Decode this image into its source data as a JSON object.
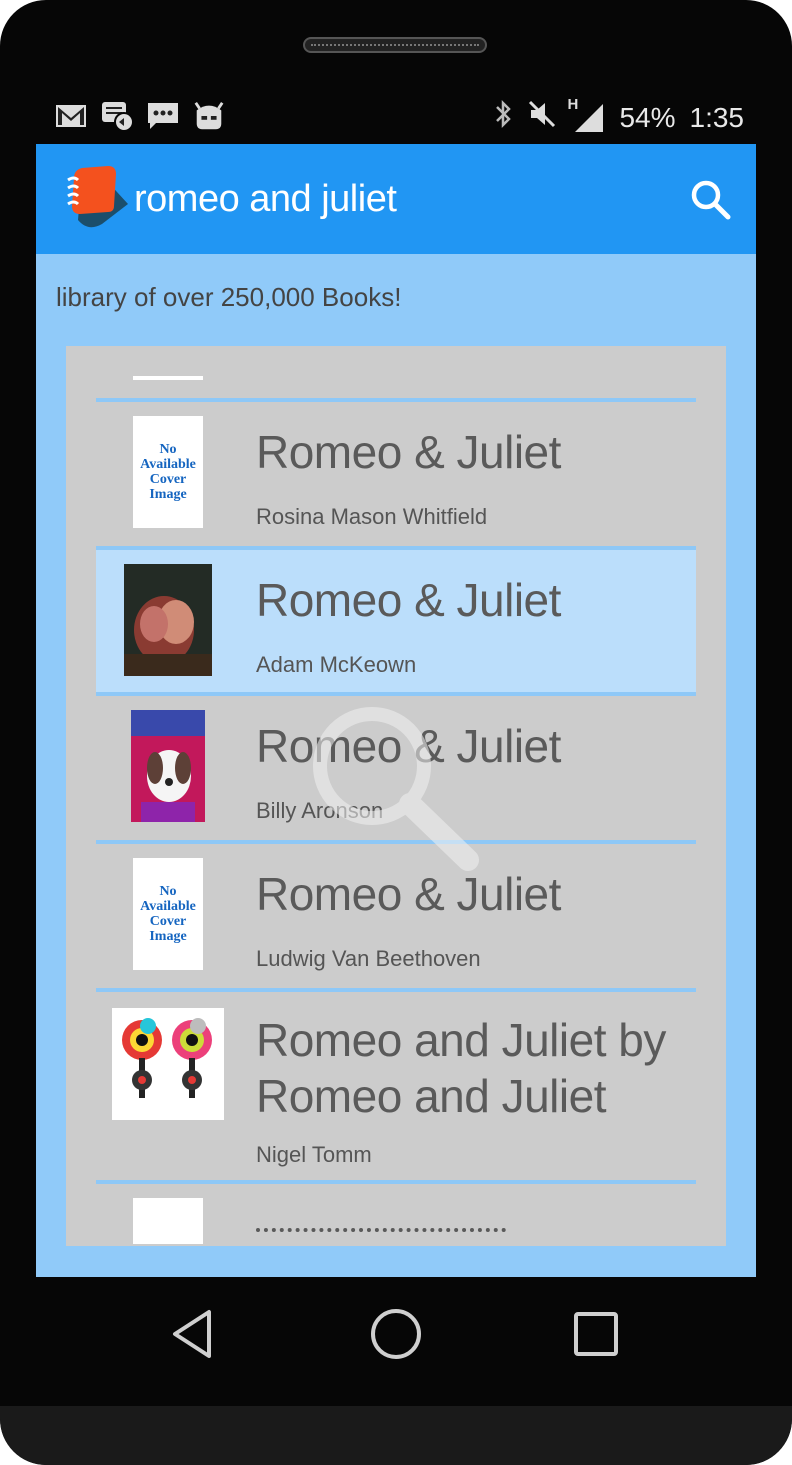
{
  "status_bar": {
    "battery": "54%",
    "time": "1:35",
    "network": "H",
    "icons": [
      "gmail-icon",
      "message-sync-icon",
      "sms-icon",
      "cyanogen-icon",
      "bluetooth-icon",
      "mute-icon",
      "signal-icon"
    ]
  },
  "app_bar": {
    "title": "romeo and juliet",
    "search_icon": "search-icon",
    "accent": "#2196f3"
  },
  "subtitle": "library of over 250,000 Books!",
  "placeholder_cover": {
    "line1": "No",
    "line2": "Available",
    "line3": "Cover",
    "line4": "Image"
  },
  "books": [
    {
      "title": "Romeo & Juliet",
      "author": "Rosina Mason Whitfield",
      "cover": "no-cover",
      "selected": false
    },
    {
      "title": "Romeo & Juliet",
      "author": "Adam McKeown",
      "cover": "painting",
      "selected": true
    },
    {
      "title": "Romeo & Juliet",
      "author": "Billy Aronson",
      "cover": "dog-costume",
      "selected": false
    },
    {
      "title": "Romeo & Juliet",
      "author": "Ludwig Van Beethoven",
      "cover": "no-cover",
      "selected": false
    },
    {
      "title": "Romeo and Juliet by Romeo and Juliet",
      "author": "Nigel Tomm",
      "cover": "illustration",
      "selected": false
    }
  ],
  "colors": {
    "screen_bg": "#90caf9",
    "list_bg": "#cccccc",
    "divider": "#8ec8f7",
    "selected_row": "#bbdefb"
  },
  "nav_bar": {
    "back_icon": "back-triangle-icon",
    "home_icon": "home-circle-icon",
    "recents_icon": "recents-square-icon"
  }
}
